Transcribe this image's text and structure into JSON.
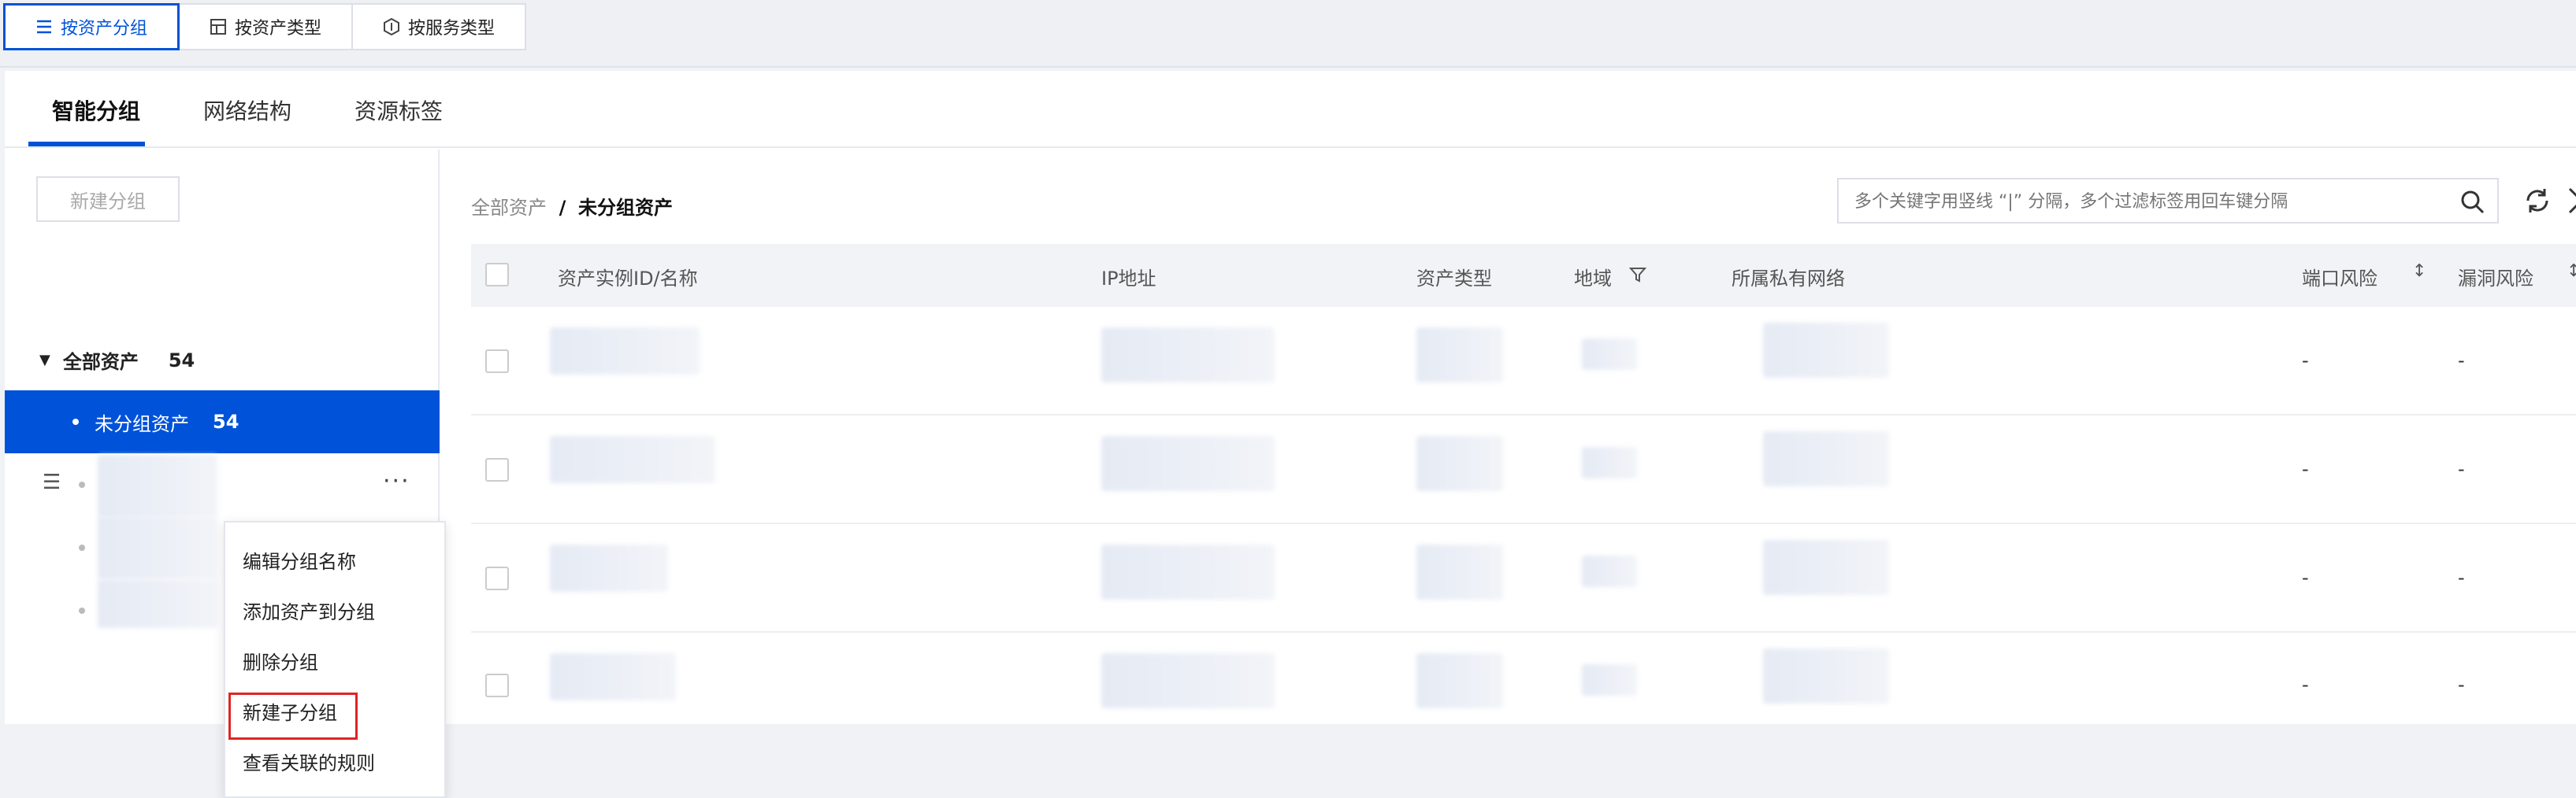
{
  "view_tabs": [
    {
      "label": "按资产分组",
      "icon": "list-icon",
      "active": true
    },
    {
      "label": "按资产类型",
      "icon": "grid-icon",
      "active": false
    },
    {
      "label": "按服务类型",
      "icon": "hexagon-icon",
      "active": false
    }
  ],
  "sub_tabs": [
    "智能分组",
    "网络结构",
    "资源标签"
  ],
  "sidebar": {
    "new_group_button": "新建分组",
    "root": {
      "label": "全部资产",
      "count": "54"
    },
    "selected": {
      "label": "未分组资产",
      "count": "54"
    }
  },
  "context_menu": {
    "items": [
      "编辑分组名称",
      "添加资产到分组",
      "删除分组",
      "新建子分组",
      "查看关联的规则"
    ],
    "highlighted": "新建子分组"
  },
  "breadcrumb": {
    "root": "全部资产",
    "separator": "/",
    "current": "未分组资产"
  },
  "search": {
    "placeholder": "多个关键字用竖线 “|” 分隔，多个过滤标签用回车键分隔"
  },
  "table": {
    "columns": [
      "资产实例ID/名称",
      "IP地址",
      "资产类型",
      "地域",
      "所属私有网络",
      "端口风险",
      "漏洞风险"
    ],
    "rows": [
      {
        "port_risk": "-",
        "vuln_risk": "-"
      },
      {
        "port_risk": "-",
        "vuln_risk": "-"
      },
      {
        "port_risk": "-",
        "vuln_risk": "-"
      },
      {
        "port_risk": "-",
        "vuln_risk": "-"
      }
    ]
  },
  "colors": {
    "accent": "#0052d9",
    "highlight_border": "#e02424"
  }
}
